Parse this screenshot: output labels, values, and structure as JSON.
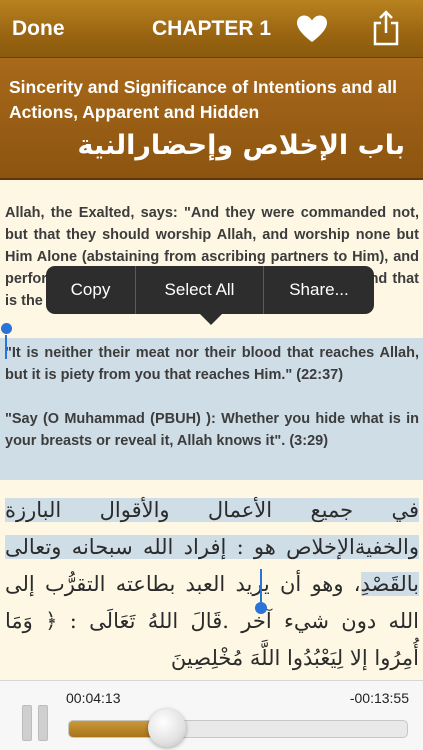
{
  "navbar": {
    "done_label": "Done",
    "title": "CHAPTER 1",
    "heart_icon": "heart-icon",
    "share_icon": "share-icon"
  },
  "chapter": {
    "title_en": "Sincerity and Significance of Intentions and all Actions, Apparent and Hidden",
    "title_ar": "باب الإخلاص وإحضارالنية"
  },
  "content": {
    "para1": "Allah, the Exalted, says: \"And they were commanded not, but that they should worship Allah, and worship none but Him Alone (abstaining from ascribing partners to Him), and perform As-Salat (Iqamat-as-Salat) and give Zakat, and that is the right religion.\" (98:5)",
    "para2": "\"It is neither their meat nor their blood that reaches Allah, but it is piety from you that reaches Him.\" (22:37)",
    "para3": "\"Say (O Muhammad (PBUH) ): Whether you hide what is in your breasts or reveal it, Allah knows it\". (3:29)",
    "arabic_selected": "في جميع الأعمال والأقوال البارزة والخفيةالإخلاص هو : إفراد الله سبحانه وتعالى بالقَصْدِ",
    "arabic_rest": "، وهو أن يريد العبد بطاعته التقرُّب إلى الله دون شيء آخر .قَالَ اللهُ تَعَالَى : ﴿ وَمَا أُمِرُوا إلا لِيَعْبُدُوا اللَّهَ مُخْلِصِينَ"
  },
  "context_menu": {
    "copy": "Copy",
    "select_all": "Select All",
    "share": "Share..."
  },
  "player": {
    "elapsed": "00:04:13",
    "remaining": "-00:13:55",
    "progress": 0.29,
    "pause_icon": "pause-icon",
    "accent": "#b07a1f"
  },
  "colors": {
    "nav_brown": "#9a6512",
    "selection": "#cfdde6",
    "selection_handle": "#2a73d8"
  }
}
